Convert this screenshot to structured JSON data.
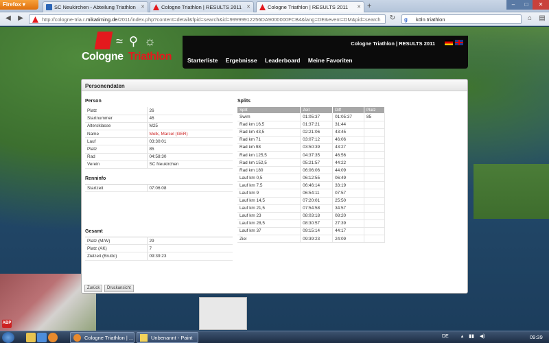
{
  "browser": {
    "app_button": "Firefox",
    "tabs": [
      {
        "label": "SC Neukirchen - Abteilung Triathlon",
        "active": false
      },
      {
        "label": "Cologne Triathlon | RESULTS 2011",
        "active": false
      },
      {
        "label": "Cologne Triathlon | RESULTS 2011",
        "active": true
      }
    ],
    "url_prefix": "http://cologne-tria.r.",
    "url_domain": "mikatiming.de",
    "url_rest": "/2011/index.php?content=detail&fpid=search&id=99999912256DA9000000FCB4&lang=DE&event=DM&pid=search",
    "search_value": "köln triathlon"
  },
  "site": {
    "logo_cologne": "Cologne",
    "logo_triathlon": "Triathlon",
    "brand_title": "Cologne Triathlon | RESULTS 2011",
    "nav": [
      "Starterliste",
      "Ergebnisse",
      "Leaderboard",
      "Meine Favoriten"
    ]
  },
  "card": {
    "title": "Personendaten",
    "person_title": "Person",
    "person": [
      {
        "k": "Platz",
        "v": "26"
      },
      {
        "k": "Startnummer",
        "v": "46"
      },
      {
        "k": "Altersklasse",
        "v": "M25"
      },
      {
        "k": "Name",
        "v": "Melk, Marcel (GER)",
        "red": true
      },
      {
        "k": "Lauf",
        "v": "03:30:01"
      },
      {
        "k": "Platz",
        "v": "85"
      },
      {
        "k": "Rad",
        "v": "04:58:30"
      },
      {
        "k": "Verein",
        "v": "SC Neukirchen"
      }
    ],
    "renninfo_title": "Renninfo",
    "renninfo": [
      {
        "k": "Startzeit",
        "v": "07:06:08"
      }
    ],
    "gesamt_title": "Gesamt",
    "gesamt": [
      {
        "k": "Platz (M/W)",
        "v": "29"
      },
      {
        "k": "Platz (AK)",
        "v": "7"
      },
      {
        "k": "Zielzeit (Brutto)",
        "v": "09:39:23"
      }
    ],
    "splits_title": "Splits",
    "splits_headers": [
      "Split",
      "Zeit",
      "Diff",
      "Platz"
    ],
    "splits": [
      [
        "Swim",
        "01:05:37",
        "01:05:37",
        "85"
      ],
      [
        "Rad km 16,5",
        "01:37:21",
        "31:44",
        ""
      ],
      [
        "Rad km 43,5",
        "02:21:06",
        "43:45",
        ""
      ],
      [
        "Rad km 71",
        "03:07:12",
        "46:06",
        ""
      ],
      [
        "Rad km 98",
        "03:50:39",
        "43:27",
        ""
      ],
      [
        "Rad km 125,5",
        "04:37:35",
        "46:56",
        ""
      ],
      [
        "Rad km 152,5",
        "05:21:57",
        "44:22",
        ""
      ],
      [
        "Rad km 180",
        "06:06:06",
        "44:09",
        ""
      ],
      [
        "Lauf km 0,5",
        "06:12:55",
        "06:49",
        ""
      ],
      [
        "Lauf km 7,5",
        "06:46:14",
        "33:19",
        ""
      ],
      [
        "Lauf km 9",
        "06:54:11",
        "07:57",
        ""
      ],
      [
        "Lauf km 14,5",
        "07:20:01",
        "25:50",
        ""
      ],
      [
        "Lauf km 21,5",
        "07:54:58",
        "34:57",
        ""
      ],
      [
        "Lauf km 23",
        "08:03:18",
        "08:20",
        ""
      ],
      [
        "Lauf km 28,5",
        "08:30:57",
        "27:39",
        ""
      ],
      [
        "Lauf km 37",
        "09:15:14",
        "44:17",
        ""
      ],
      [
        "Ziel",
        "09:39:23",
        "24:09",
        ""
      ]
    ],
    "btn_back": "Zurück",
    "btn_print": "Druckansicht"
  },
  "taskbar": {
    "tasks": [
      "Cologne Triathlon | ...",
      "Unbenannt - Paint"
    ],
    "lang": "DE",
    "clock": "09:39"
  },
  "colors": {
    "accent_red": "#e3191d",
    "nav_bg": "#0b0b0b"
  }
}
